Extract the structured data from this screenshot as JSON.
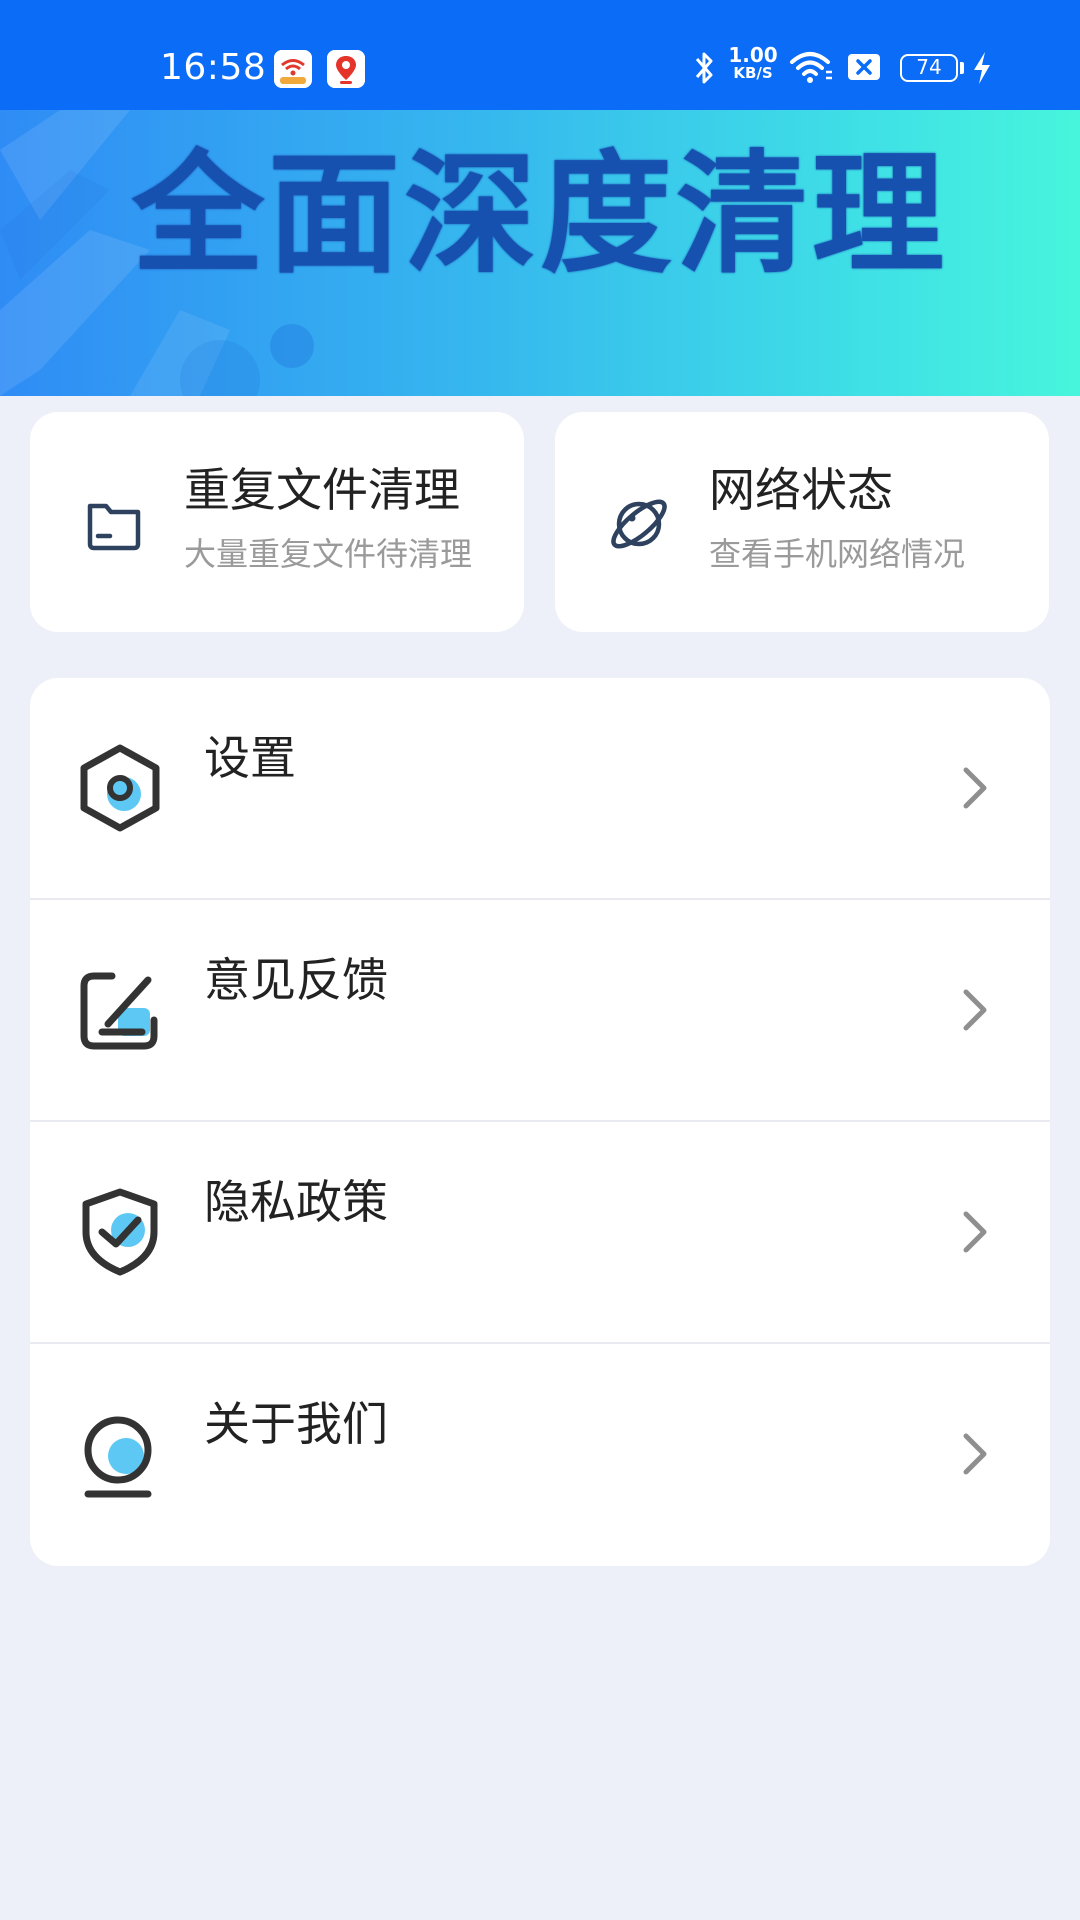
{
  "status_bar": {
    "time": "16:58",
    "net_speed_value": "1.00",
    "net_speed_unit": "KB/S",
    "battery_level": "74",
    "icons": [
      "wifi-app-icon",
      "map-app-icon",
      "bluetooth-icon",
      "wifi-icon",
      "sim-icon",
      "battery-icon",
      "charging-icon"
    ]
  },
  "banner": {
    "title": "全面深度清理"
  },
  "cards": [
    {
      "title": "重复文件清理",
      "subtitle": "大量重复文件待清理",
      "icon": "folder-icon"
    },
    {
      "title": "网络状态",
      "subtitle": "查看手机网络情况",
      "icon": "planet-icon"
    }
  ],
  "menu": [
    {
      "label": "设置",
      "icon": "settings-icon"
    },
    {
      "label": "意见反馈",
      "icon": "feedback-icon"
    },
    {
      "label": "隐私政策",
      "icon": "privacy-shield-icon"
    },
    {
      "label": "关于我们",
      "icon": "about-user-icon"
    }
  ],
  "colors": {
    "status_bar": "#0a6cf7",
    "banner_start": "#2f8cf5",
    "banner_end": "#47f5dc",
    "banner_title": "#1751b0",
    "background": "#edf0f8",
    "icon_accent": "#5ec8f5",
    "icon_stroke": "#333333"
  }
}
